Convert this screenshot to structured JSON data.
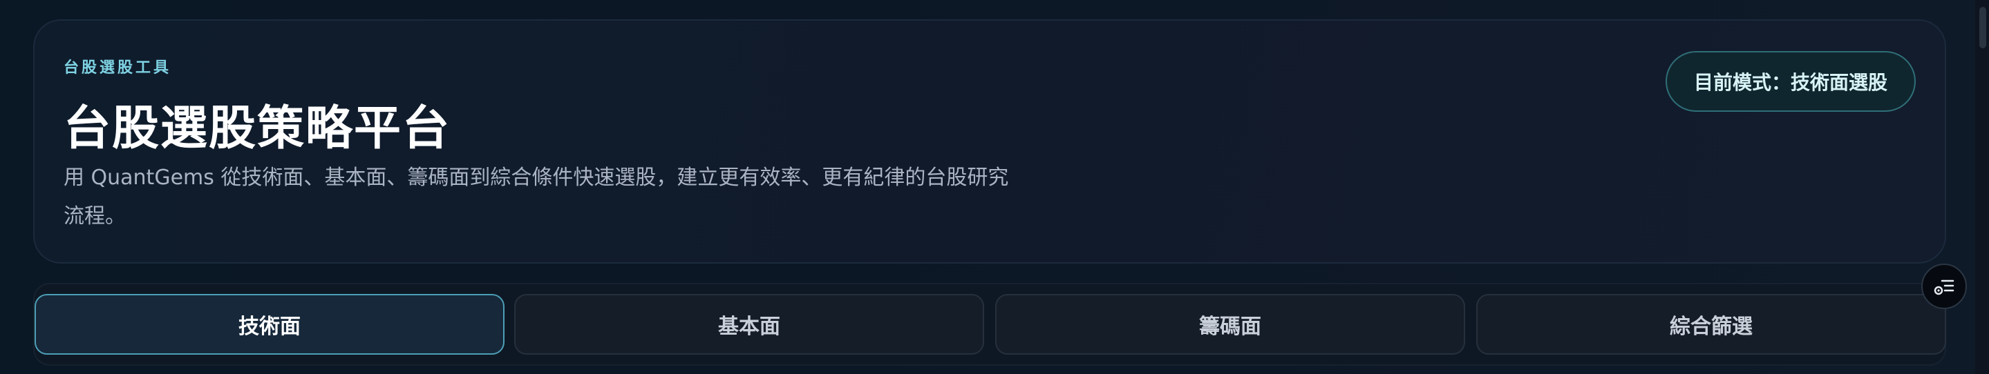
{
  "hero": {
    "eyebrow": "台股選股工具",
    "title": "台股選股策略平台",
    "description": "用 QuantGems 從技術面、基本面、籌碼面到綜合條件快速選股，建立更有效率、更有紀律的台股研究流程。",
    "mode_label": "目前模式：技術面選股"
  },
  "tabs": [
    {
      "label": "技術面",
      "active": true
    },
    {
      "label": "基本面",
      "active": false
    },
    {
      "label": "籌碼面",
      "active": false
    },
    {
      "label": "綜合篩選",
      "active": false
    }
  ],
  "fab": {
    "icon": "filter-list-icon"
  },
  "colors": {
    "accent": "#7ed3e3",
    "active_tab_border": "#4d9fb7",
    "background": "#0b1420"
  }
}
